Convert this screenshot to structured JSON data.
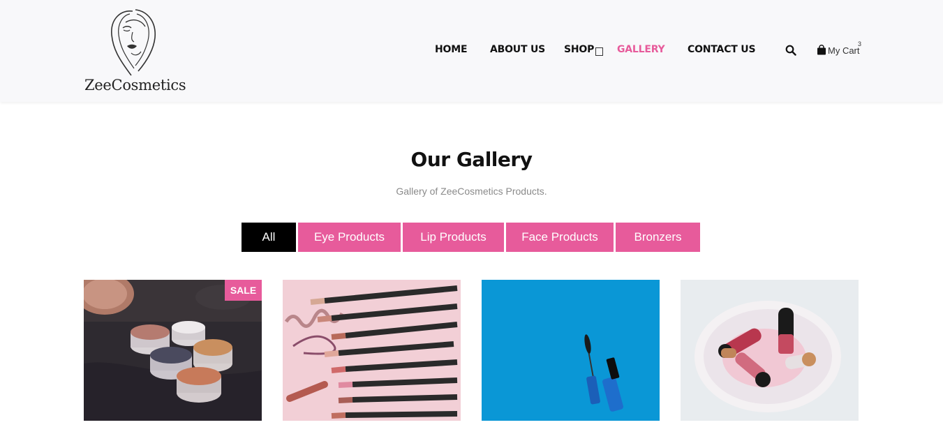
{
  "brand": {
    "name": "ZeeCosmetics"
  },
  "nav": {
    "items": [
      {
        "label": "HOME",
        "active": false
      },
      {
        "label": "ABOUT US",
        "active": false
      },
      {
        "label": "SHOP",
        "active": false
      },
      {
        "label": "GALLERY",
        "active": true
      },
      {
        "label": "CONTACT US",
        "active": false
      }
    ],
    "cart_label": "My Cart",
    "cart_count": "3"
  },
  "gallery": {
    "title": "Our Gallery",
    "subtitle": "Gallery of ZeeCosmetics Products.",
    "filters": [
      {
        "label": "All",
        "active": true
      },
      {
        "label": "Eye Products",
        "active": false
      },
      {
        "label": "Lip Products",
        "active": false
      },
      {
        "label": "Face Products",
        "active": false
      },
      {
        "label": "Bronzers",
        "active": false
      }
    ],
    "items": [
      {
        "badge": "SALE"
      },
      {
        "badge": ""
      },
      {
        "badge": ""
      },
      {
        "badge": ""
      }
    ]
  },
  "colors": {
    "accent": "#e75b9b",
    "active_filter": "#000000",
    "header_bg": "#f8f8fa"
  }
}
